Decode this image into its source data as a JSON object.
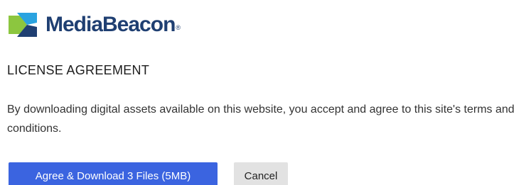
{
  "brand": {
    "name": "MediaBeacon",
    "registered_mark": "®",
    "logo_icon": "mediabeacon-logo-icon",
    "colors": {
      "navy": "#1f3f72",
      "blue": "#2aa3e0",
      "green": "#8cc63f"
    }
  },
  "license": {
    "heading": "LICENSE AGREEMENT",
    "message": "By downloading digital assets available on this website, you accept and agree to this site's terms and conditions."
  },
  "actions": {
    "agree_label": "Agree & Download 3 Files (5MB)",
    "cancel_label": "Cancel",
    "primary_color": "#3b64e0"
  }
}
